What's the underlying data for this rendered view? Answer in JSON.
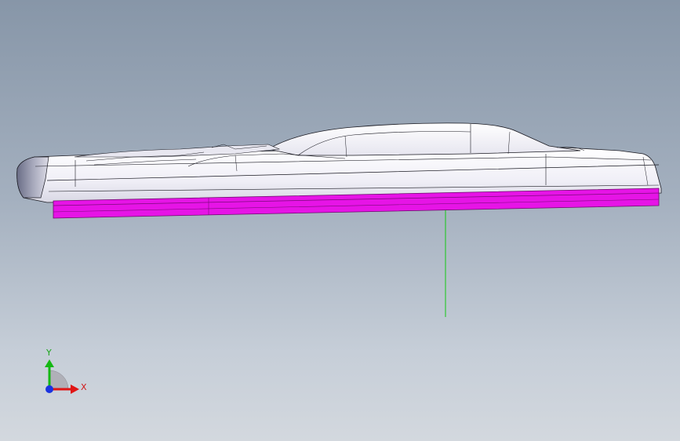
{
  "triad": {
    "x_label": "X",
    "y_label": "Y",
    "colors": {
      "x": "#e01515",
      "y": "#14b814",
      "z": "#1a33e0"
    }
  },
  "colors": {
    "viewport_top": "#8796a8",
    "viewport_bottom": "#d3d8de",
    "part_body": "#f2f2f8",
    "part_edges": "#1a1a22",
    "selected_face": "#e614e6",
    "origin_axis": "#14c814"
  }
}
